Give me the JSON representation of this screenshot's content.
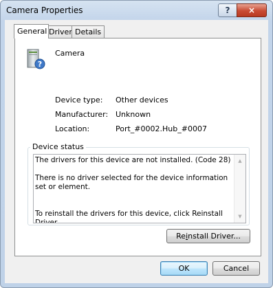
{
  "window": {
    "title": "Camera Properties",
    "help_glyph": "?",
    "close_glyph": "×"
  },
  "tabs": [
    {
      "label": "General",
      "active": true
    },
    {
      "label": "Driver",
      "active": false
    },
    {
      "label": "Details",
      "active": false
    }
  ],
  "device": {
    "name": "Camera",
    "icon": "camera-device-unknown-icon",
    "properties": [
      {
        "label": "Device type:",
        "value": "Other devices"
      },
      {
        "label": "Manufacturer:",
        "value": "Unknown"
      },
      {
        "label": "Location:",
        "value": "Port_#0002.Hub_#0007"
      }
    ]
  },
  "status": {
    "group_label": "Device status",
    "text": "The drivers for this device are not installed. (Code 28)\n\nThere is no driver selected for the device information set or element.\n\n\nTo reinstall the drivers for this device, click Reinstall Driver."
  },
  "buttons": {
    "reinstall": {
      "before": "Re",
      "mnemonic": "i",
      "after": "nstall Driver..."
    },
    "ok": "OK",
    "cancel": "Cancel"
  },
  "colors": {
    "accent": "#3c7fb1",
    "close": "#c84a33"
  }
}
